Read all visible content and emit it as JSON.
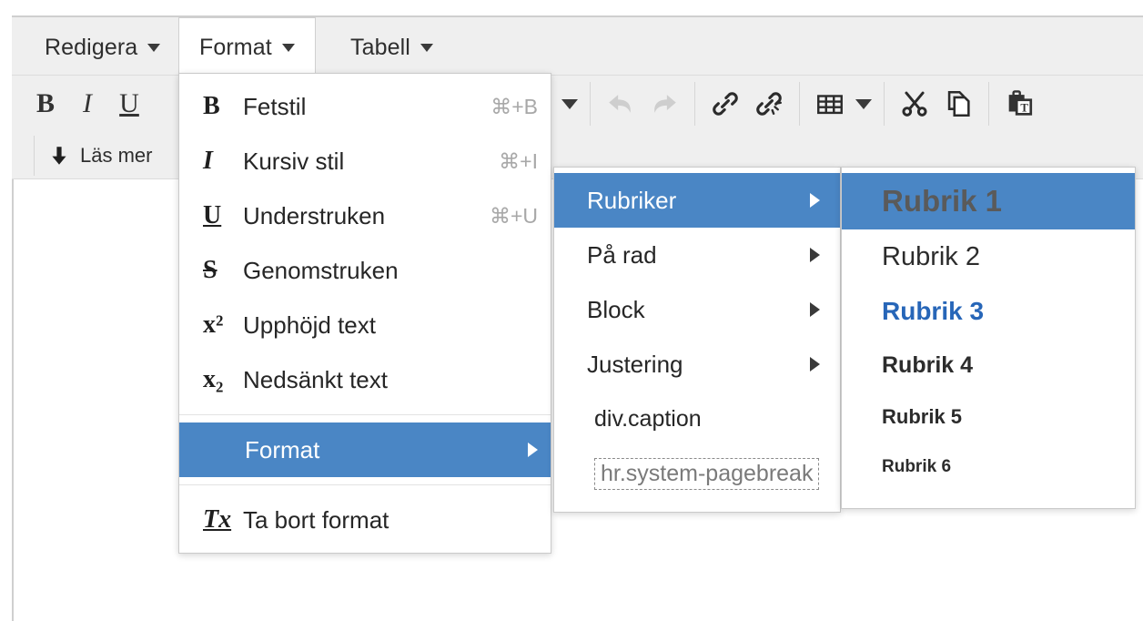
{
  "menubar": {
    "tabs": [
      {
        "label": "Redigera",
        "icon": "chevron-down-icon",
        "active": false
      },
      {
        "label": "Format",
        "icon": "chevron-down-icon",
        "active": true
      },
      {
        "label": "Tabell",
        "icon": "chevron-down-icon",
        "active": false
      }
    ]
  },
  "toolbar": {
    "row1": [
      {
        "name": "bold-button",
        "glyph": "B"
      },
      {
        "name": "italic-button",
        "glyph": "I"
      },
      {
        "name": "underline-button",
        "glyph": "U"
      }
    ],
    "row2": [
      {
        "name": "read-more-button",
        "label": "Läs mer",
        "icon": "down-arrow-icon"
      }
    ],
    "right_tools": [
      {
        "name": "numbered-list-button",
        "icon": "numbered-list-icon"
      },
      {
        "name": "numbered-list-dropdown",
        "icon": "caret-down-icon"
      },
      {
        "name": "undo-button",
        "icon": "undo-arrow-icon",
        "disabled": true
      },
      {
        "name": "redo-button",
        "icon": "redo-arrow-icon",
        "disabled": true
      },
      {
        "name": "insert-link-button",
        "icon": "link-icon"
      },
      {
        "name": "unlink-button",
        "icon": "unlink-icon"
      },
      {
        "name": "table-button",
        "icon": "table-icon"
      },
      {
        "name": "table-dropdown",
        "icon": "caret-down-icon"
      },
      {
        "name": "cut-button",
        "icon": "scissors-icon"
      },
      {
        "name": "copy-button",
        "icon": "copy-icon"
      },
      {
        "name": "paste-as-text-button",
        "icon": "paste-text-icon"
      }
    ]
  },
  "format_menu": {
    "items": [
      {
        "icon_glyph": "B",
        "icon_style": "bold",
        "label": "Fetstil",
        "shortcut": "⌘+B"
      },
      {
        "icon_glyph": "I",
        "icon_style": "italic",
        "label": "Kursiv stil",
        "shortcut": "⌘+I"
      },
      {
        "icon_glyph": "U",
        "icon_style": "underline",
        "label": "Understruken",
        "shortcut": "⌘+U"
      },
      {
        "icon_glyph": "S",
        "icon_style": "strike",
        "label": "Genomstruken",
        "shortcut": ""
      },
      {
        "icon_glyph": "x²",
        "icon_style": "superscript",
        "label": "Upphöjd text",
        "shortcut": ""
      },
      {
        "icon_glyph": "x₂",
        "icon_style": "subscript",
        "label": "Nedsänkt text",
        "shortcut": ""
      }
    ],
    "submenu_item": {
      "label": "Format",
      "selected": true,
      "arrow": "submenu-arrow-icon"
    },
    "clear_item": {
      "icon_glyph": "Tx",
      "label": "Ta bort format"
    }
  },
  "format_submenu": {
    "items": [
      {
        "label": "Rubriker",
        "has_arrow": true,
        "selected": true,
        "style": "normal"
      },
      {
        "label": "På rad",
        "has_arrow": true,
        "selected": false,
        "style": "normal"
      },
      {
        "label": "Block",
        "has_arrow": true,
        "selected": false,
        "style": "normal"
      },
      {
        "label": "Justering",
        "has_arrow": true,
        "selected": false,
        "style": "normal"
      },
      {
        "label": "div.caption",
        "has_arrow": false,
        "selected": false,
        "style": "plain"
      },
      {
        "label": "hr.system-pagebreak",
        "has_arrow": false,
        "selected": false,
        "style": "dashed"
      }
    ]
  },
  "headings_submenu": {
    "items": [
      {
        "label": "Rubrik 1",
        "level": 1,
        "selected": true
      },
      {
        "label": "Rubrik 2",
        "level": 2,
        "selected": false
      },
      {
        "label": "Rubrik 3",
        "level": 3,
        "selected": false
      },
      {
        "label": "Rubrik 4",
        "level": 4,
        "selected": false
      },
      {
        "label": "Rubrik 5",
        "level": 5,
        "selected": false
      },
      {
        "label": "Rubrik 6",
        "level": 6,
        "selected": false
      }
    ]
  },
  "colors": {
    "highlight_blue": "#4a86c5",
    "toolbar_bg": "#efefef",
    "panel_bg": "#ffffff",
    "border": "#cacaca",
    "heading3_blue": "#2766b8",
    "shortcut_gray": "#a8a8a8"
  }
}
